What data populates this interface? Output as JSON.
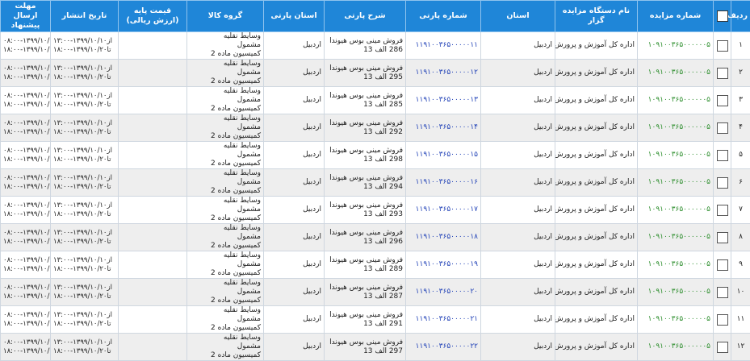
{
  "headers": {
    "row_no": "ردیف",
    "auction_no": "شماره مزایده",
    "org": "نام دستگاه مزایده گزار",
    "province": "استان",
    "party_no": "شماره پارتی",
    "party_desc": "شرح پارتی",
    "party_province": "استان پارتی",
    "goods_group": "گروه کالا",
    "base_price": "قیمت پایه (ارزش ریالی)",
    "publish_date": "تاریخ انتشار",
    "deadline": "مهلت ارسال پیشنهاد"
  },
  "rows": [
    {
      "n": "۱",
      "auction": "۱۰۹۱۰۰۳۶۵۰۰۰۰۰۰۵",
      "org": "اداره کل آموزش و پرورش",
      "province": "اردبیل",
      "party": "۱۱۹۱۰۰۳۶۵۰۰۰۰۰۱۱",
      "desc1": "فروش مینی بوس هیوندا",
      "desc2": "286 الف 13",
      "pprov": "اردبیل",
      "g1": "وسایط نقلیه",
      "g2": "مشمول",
      "g3": "کمیسیون ماده 2",
      "price": "",
      "pub1": "از۱۳۹۹/۱۰/۱۰-۱۳:۰۰",
      "pub2": "تا۱۳۹۹/۱۰/۲۰-۱۸:۰۰",
      "dl1": "از۱۳۹۹/۱۰/۱۹-۰۸:۰۰",
      "dl2": "تا۱۳۹۹/۱۰/۲۰-۱۸:۰۰"
    },
    {
      "n": "۲",
      "auction": "۱۰۹۱۰۰۳۶۵۰۰۰۰۰۰۵",
      "org": "اداره کل آموزش و پرورش",
      "province": "اردبیل",
      "party": "۱۱۹۱۰۰۳۶۵۰۰۰۰۰۱۲",
      "desc1": "فروش مینی بوس هیوندا",
      "desc2": "295 الف 13",
      "pprov": "اردبیل",
      "g1": "وسایط نقلیه",
      "g2": "مشمول",
      "g3": "کمیسیون ماده 2",
      "price": "",
      "pub1": "از۱۳۹۹/۱۰/۱۰-۱۳:۰۰",
      "pub2": "تا۱۳۹۹/۱۰/۲۰-۱۸:۰۰",
      "dl1": "از۱۳۹۹/۱۰/۱۹-۰۸:۰۰",
      "dl2": "تا۱۳۹۹/۱۰/۲۰-۱۸:۰۰"
    },
    {
      "n": "۳",
      "auction": "۱۰۹۱۰۰۳۶۵۰۰۰۰۰۰۵",
      "org": "اداره کل آموزش و پرورش",
      "province": "اردبیل",
      "party": "۱۱۹۱۰۰۳۶۵۰۰۰۰۰۱۳",
      "desc1": "فروش مینی بوس هیوندا",
      "desc2": "285 الف 13",
      "pprov": "اردبیل",
      "g1": "وسایط نقلیه",
      "g2": "مشمول",
      "g3": "کمیسیون ماده 2",
      "price": "",
      "pub1": "از۱۳۹۹/۱۰/۱۰-۱۳:۰۰",
      "pub2": "تا۱۳۹۹/۱۰/۲۰-۱۸:۰۰",
      "dl1": "از۱۳۹۹/۱۰/۱۹-۰۸:۰۰",
      "dl2": "تا۱۳۹۹/۱۰/۲۰-۱۸:۰۰"
    },
    {
      "n": "۴",
      "auction": "۱۰۹۱۰۰۳۶۵۰۰۰۰۰۰۵",
      "org": "اداره کل آموزش و پرورش",
      "province": "اردبیل",
      "party": "۱۱۹۱۰۰۳۶۵۰۰۰۰۰۱۴",
      "desc1": "فروش مینی بوس هیوندا",
      "desc2": "292 الف 13",
      "pprov": "اردبیل",
      "g1": "وسایط نقلیه",
      "g2": "مشمول",
      "g3": "کمیسیون ماده 2",
      "price": "",
      "pub1": "از۱۳۹۹/۱۰/۱۰-۱۳:۰۰",
      "pub2": "تا۱۳۹۹/۱۰/۲۰-۱۸:۰۰",
      "dl1": "از۱۳۹۹/۱۰/۱۹-۰۸:۰۰",
      "dl2": "تا۱۳۹۹/۱۰/۲۰-۱۸:۰۰"
    },
    {
      "n": "۵",
      "auction": "۱۰۹۱۰۰۳۶۵۰۰۰۰۰۰۵",
      "org": "اداره کل آموزش و پرورش",
      "province": "اردبیل",
      "party": "۱۱۹۱۰۰۳۶۵۰۰۰۰۰۱۵",
      "desc1": "فروش مینی بوس هیوندا",
      "desc2": "298 الف 13",
      "pprov": "اردبیل",
      "g1": "وسایط نقلیه",
      "g2": "مشمول",
      "g3": "کمیسیون ماده 2",
      "price": "",
      "pub1": "از۱۳۹۹/۱۰/۱۰-۱۳:۰۰",
      "pub2": "تا۱۳۹۹/۱۰/۲۰-۱۸:۰۰",
      "dl1": "از۱۳۹۹/۱۰/۱۹-۰۸:۰۰",
      "dl2": "تا۱۳۹۹/۱۰/۲۰-۱۸:۰۰"
    },
    {
      "n": "۶",
      "auction": "۱۰۹۱۰۰۳۶۵۰۰۰۰۰۰۵",
      "org": "اداره کل آموزش و پرورش",
      "province": "اردبیل",
      "party": "۱۱۹۱۰۰۳۶۵۰۰۰۰۰۱۶",
      "desc1": "فروش مینی بوس هیوندا",
      "desc2": "294 الف 13",
      "pprov": "اردبیل",
      "g1": "وسایط نقلیه",
      "g2": "مشمول",
      "g3": "کمیسیون ماده 2",
      "price": "",
      "pub1": "از۱۳۹۹/۱۰/۱۰-۱۳:۰۰",
      "pub2": "تا۱۳۹۹/۱۰/۲۰-۱۸:۰۰",
      "dl1": "از۱۳۹۹/۱۰/۱۹-۰۸:۰۰",
      "dl2": "تا۱۳۹۹/۱۰/۲۰-۱۸:۰۰"
    },
    {
      "n": "۷",
      "auction": "۱۰۹۱۰۰۳۶۵۰۰۰۰۰۰۵",
      "org": "اداره کل آموزش و پرورش",
      "province": "اردبیل",
      "party": "۱۱۹۱۰۰۳۶۵۰۰۰۰۰۱۷",
      "desc1": "فروش مینی بوس هیوندا",
      "desc2": "293 الف 13",
      "pprov": "اردبیل",
      "g1": "وسایط نقلیه",
      "g2": "مشمول",
      "g3": "کمیسیون ماده 2",
      "price": "",
      "pub1": "از۱۳۹۹/۱۰/۱۰-۱۳:۰۰",
      "pub2": "تا۱۳۹۹/۱۰/۲۰-۱۸:۰۰",
      "dl1": "از۱۳۹۹/۱۰/۱۹-۰۸:۰۰",
      "dl2": "تا۱۳۹۹/۱۰/۲۰-۱۸:۰۰"
    },
    {
      "n": "۸",
      "auction": "۱۰۹۱۰۰۳۶۵۰۰۰۰۰۰۵",
      "org": "اداره کل آموزش و پرورش",
      "province": "اردبیل",
      "party": "۱۱۹۱۰۰۳۶۵۰۰۰۰۰۱۸",
      "desc1": "فروش مینی بوس هیوندا",
      "desc2": "296 الف 13",
      "pprov": "اردبیل",
      "g1": "وسایط نقلیه",
      "g2": "مشمول",
      "g3": "کمیسیون ماده 2",
      "price": "",
      "pub1": "از۱۳۹۹/۱۰/۱۰-۱۳:۰۰",
      "pub2": "تا۱۳۹۹/۱۰/۲۰-۱۸:۰۰",
      "dl1": "از۱۳۹۹/۱۰/۱۹-۰۸:۰۰",
      "dl2": "تا۱۳۹۹/۱۰/۲۰-۱۸:۰۰"
    },
    {
      "n": "۹",
      "auction": "۱۰۹۱۰۰۳۶۵۰۰۰۰۰۰۵",
      "org": "اداره کل آموزش و پرورش",
      "province": "اردبیل",
      "party": "۱۱۹۱۰۰۳۶۵۰۰۰۰۰۱۹",
      "desc1": "فروش مینی بوس هیوندا",
      "desc2": "289 الف 13",
      "pprov": "اردبیل",
      "g1": "وسایط نقلیه",
      "g2": "مشمول",
      "g3": "کمیسیون ماده 2",
      "price": "",
      "pub1": "از۱۳۹۹/۱۰/۱۰-۱۳:۰۰",
      "pub2": "تا۱۳۹۹/۱۰/۲۰-۱۸:۰۰",
      "dl1": "از۱۳۹۹/۱۰/۱۹-۰۸:۰۰",
      "dl2": "تا۱۳۹۹/۱۰/۲۰-۱۸:۰۰"
    },
    {
      "n": "۱۰",
      "auction": "۱۰۹۱۰۰۳۶۵۰۰۰۰۰۰۵",
      "org": "اداره کل آموزش و پرورش",
      "province": "اردبیل",
      "party": "۱۱۹۱۰۰۳۶۵۰۰۰۰۰۲۰",
      "desc1": "فروش مینی بوس هیوندا",
      "desc2": "287 الف 13",
      "pprov": "اردبیل",
      "g1": "وسایط نقلیه",
      "g2": "مشمول",
      "g3": "کمیسیون ماده 2",
      "price": "",
      "pub1": "از۱۳۹۹/۱۰/۱۰-۱۳:۰۰",
      "pub2": "تا۱۳۹۹/۱۰/۲۰-۱۸:۰۰",
      "dl1": "از۱۳۹۹/۱۰/۱۹-۰۸:۰۰",
      "dl2": "تا۱۳۹۹/۱۰/۲۰-۱۸:۰۰"
    },
    {
      "n": "۱۱",
      "auction": "۱۰۹۱۰۰۳۶۵۰۰۰۰۰۰۵",
      "org": "اداره کل آموزش و پرورش",
      "province": "اردبیل",
      "party": "۱۱۹۱۰۰۳۶۵۰۰۰۰۰۲۱",
      "desc1": "فروش مینی بوس هیوندا",
      "desc2": "291 الف 13",
      "pprov": "اردبیل",
      "g1": "وسایط نقلیه",
      "g2": "مشمول",
      "g3": "کمیسیون ماده 2",
      "price": "",
      "pub1": "از۱۳۹۹/۱۰/۱۰-۱۳:۰۰",
      "pub2": "تا۱۳۹۹/۱۰/۲۰-۱۸:۰۰",
      "dl1": "از۱۳۹۹/۱۰/۱۹-۰۸:۰۰",
      "dl2": "تا۱۳۹۹/۱۰/۲۰-۱۸:۰۰"
    },
    {
      "n": "۱۲",
      "auction": "۱۰۹۱۰۰۳۶۵۰۰۰۰۰۰۵",
      "org": "اداره کل آموزش و پرورش",
      "province": "اردبیل",
      "party": "۱۱۹۱۰۰۳۶۵۰۰۰۰۰۲۲",
      "desc1": "فروش مینی بوس هیوندا",
      "desc2": "297 الف 13",
      "pprov": "اردبیل",
      "g1": "وسایط نقلیه",
      "g2": "مشمول",
      "g3": "کمیسیون ماده 2",
      "price": "",
      "pub1": "از۱۳۹۹/۱۰/۱۰-۱۳:۰۰",
      "pub2": "تا۱۳۹۹/۱۰/۲۰-۱۸:۰۰",
      "dl1": "از۱۳۹۹/۱۰/۱۹-۰۸:۰۰",
      "dl2": "تا۱۳۹۹/۱۰/۲۰-۱۸:۰۰"
    }
  ],
  "colors": {
    "header_bg": "#1f86d8",
    "auction_no": "#2f8f2f",
    "party_no": "#2545b8",
    "row_alt": "#eeeeee"
  }
}
